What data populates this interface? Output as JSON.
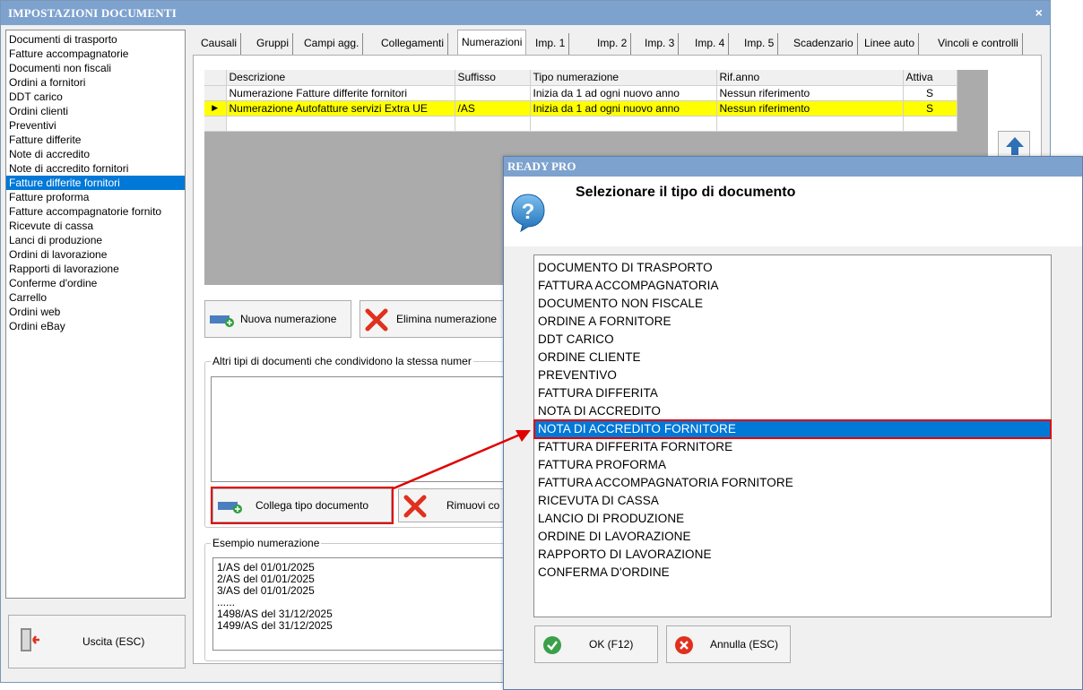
{
  "window": {
    "title": "IMPOSTAZIONI DOCUMENTI",
    "close_glyph": "×"
  },
  "sidebar": {
    "items": [
      {
        "label": "Documenti di trasporto",
        "selected": false
      },
      {
        "label": "Fatture accompagnatorie",
        "selected": false
      },
      {
        "label": "Documenti non fiscali",
        "selected": false
      },
      {
        "label": "Ordini a fornitori",
        "selected": false
      },
      {
        "label": "DDT carico",
        "selected": false
      },
      {
        "label": "Ordini clienti",
        "selected": false
      },
      {
        "label": "Preventivi",
        "selected": false
      },
      {
        "label": "Fatture differite",
        "selected": false
      },
      {
        "label": "Note di accredito",
        "selected": false
      },
      {
        "label": "Note di accredito fornitori",
        "selected": false
      },
      {
        "label": "Fatture differite fornitori",
        "selected": true
      },
      {
        "label": "Fatture proforma",
        "selected": false
      },
      {
        "label": "Fatture accompagnatorie fornito",
        "selected": false
      },
      {
        "label": "Ricevute di cassa",
        "selected": false
      },
      {
        "label": "Lanci di produzione",
        "selected": false
      },
      {
        "label": "Ordini di lavorazione",
        "selected": false
      },
      {
        "label": "Rapporti di lavorazione",
        "selected": false
      },
      {
        "label": "Conferme d'ordine",
        "selected": false
      },
      {
        "label": "Carrello",
        "selected": false
      },
      {
        "label": "Ordini web",
        "selected": false
      },
      {
        "label": "Ordini eBay",
        "selected": false
      }
    ],
    "exit_label": "Uscita (ESC)"
  },
  "tabs": [
    {
      "label": "Causali",
      "active": false
    },
    {
      "label": "Gruppi",
      "active": false
    },
    {
      "label": "Campi agg.",
      "active": false
    },
    {
      "label": "Collegamenti",
      "active": false
    },
    {
      "label": "Numerazioni",
      "active": true
    },
    {
      "label": "Imp. 1",
      "active": false
    },
    {
      "label": "Imp. 2",
      "active": false
    },
    {
      "label": "Imp. 3",
      "active": false
    },
    {
      "label": "Imp. 4",
      "active": false
    },
    {
      "label": "Imp. 5",
      "active": false
    },
    {
      "label": "Scadenzario",
      "active": false
    },
    {
      "label": "Linee auto",
      "active": false
    },
    {
      "label": "Vincoli e controlli",
      "active": false
    }
  ],
  "numbering_grid": {
    "columns": [
      "Descrizione",
      "Suffisso",
      "Tipo numerazione",
      "Rif.anno",
      "Attiva"
    ],
    "rows": [
      {
        "descrizione": "Numerazione Fatture differite fornitori",
        "suffisso": "",
        "tipo": "Inizia da 1 ad ogni nuovo anno",
        "rif_anno": "Nessun riferimento",
        "attiva": "S",
        "current": false
      },
      {
        "descrizione": "Numerazione Autofatture servizi Extra UE",
        "suffisso": "/AS",
        "tipo": "Inizia da 1 ad ogni nuovo anno",
        "rif_anno": "Nessun riferimento",
        "attiva": "S",
        "current": true
      }
    ],
    "current_row_glyph": "▶"
  },
  "buttons": {
    "new_numbering": "Nuova numerazione",
    "delete_numbering": "Elimina numerazione",
    "link_doc_type": "Collega tipo documento",
    "remove_link": "Rimuovi co"
  },
  "shared_group": {
    "legend": "Altri tipi di documenti che condividono la stessa numer"
  },
  "example_group": {
    "legend": "Esempio numerazione",
    "lines": [
      "1/AS del 01/01/2025",
      "2/AS del 01/01/2025",
      "3/AS del 01/01/2025",
      "......",
      "1498/AS del 31/12/2025",
      "1499/AS del 31/12/2025"
    ]
  },
  "dialog": {
    "title": "READY PRO",
    "prompt": "Selezionare il tipo di documento",
    "options": [
      {
        "label": "DOCUMENTO DI TRASPORTO",
        "selected": false
      },
      {
        "label": "FATTURA ACCOMPAGNATORIA",
        "selected": false
      },
      {
        "label": "DOCUMENTO NON FISCALE",
        "selected": false
      },
      {
        "label": "ORDINE A FORNITORE",
        "selected": false
      },
      {
        "label": "DDT CARICO",
        "selected": false
      },
      {
        "label": "ORDINE CLIENTE",
        "selected": false
      },
      {
        "label": "PREVENTIVO",
        "selected": false
      },
      {
        "label": "FATTURA DIFFERITA",
        "selected": false
      },
      {
        "label": "NOTA DI ACCREDITO",
        "selected": false
      },
      {
        "label": "NOTA DI ACCREDITO FORNITORE",
        "selected": true
      },
      {
        "label": "FATTURA DIFFERITA FORNITORE",
        "selected": false
      },
      {
        "label": "FATTURA PROFORMA",
        "selected": false
      },
      {
        "label": "FATTURA ACCOMPAGNATORIA FORNITORE",
        "selected": false
      },
      {
        "label": "RICEVUTA DI CASSA",
        "selected": false
      },
      {
        "label": "LANCIO DI PRODUZIONE",
        "selected": false
      },
      {
        "label": "ORDINE DI LAVORAZIONE",
        "selected": false
      },
      {
        "label": "RAPPORTO DI LAVORAZIONE",
        "selected": false
      },
      {
        "label": "CONFERMA D'ORDINE",
        "selected": false
      }
    ],
    "ok_label": "OK (F12)",
    "cancel_label": "Annulla (ESC)"
  },
  "colors": {
    "titlebar": "#7da2ce",
    "selection": "#0078d7",
    "highlight_row": "#ffff00",
    "annotation_red": "#e00000"
  }
}
